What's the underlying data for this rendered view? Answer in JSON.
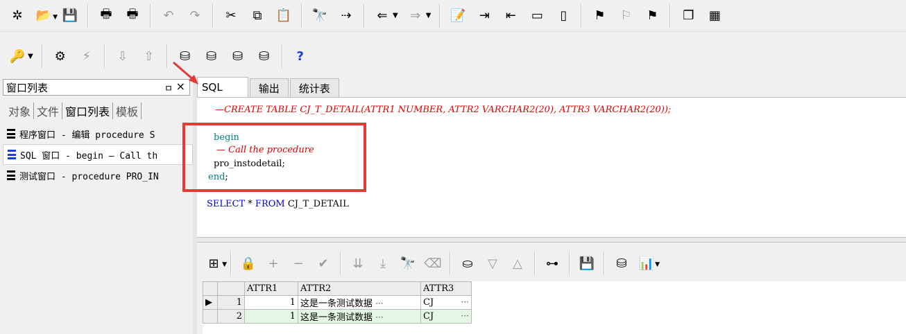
{
  "left_panel": {
    "title": "窗口列表",
    "pin_glyph": "ㅁ",
    "close_glyph": "×",
    "tabs": [
      "对象",
      "文件",
      "窗口列表",
      "模板"
    ],
    "windows": [
      {
        "label": "程序窗口 - 编辑 procedure S"
      },
      {
        "label": "SQL 窗口 - begin — Call th"
      },
      {
        "label": "测试窗口 - procedure PRO_IN"
      }
    ]
  },
  "editor_tabs": [
    "SQL",
    "输出",
    "统计表"
  ],
  "editor": {
    "line1": "—CREATE TABLE CJ_T_DETAIL(ATTR1 NUMBER, ATTR2 VARCHAR2(20), ATTR3 VARCHAR2(20));",
    "line2": "begin",
    "line3": "— Call the procedure",
    "line4": "pro_instodetail;",
    "line5_kw": "end",
    "line5_rest": ";",
    "line6_kw1": "SELECT",
    "line6_star": "*",
    "line6_kw2": "FROM",
    "line6_rest": "CJ_T_DETAIL"
  },
  "grid": {
    "columns": [
      "ATTR1",
      "ATTR2",
      "ATTR3"
    ],
    "rows": [
      {
        "num": "1",
        "attr1": "1",
        "attr2": "这是一条测试数据",
        "attr3": "CJ"
      },
      {
        "num": "2",
        "attr1": "1",
        "attr2": "这是一条测试数据",
        "attr3": "CJ"
      }
    ],
    "ellipsis": "···"
  },
  "toolbar_help": "?",
  "colors": {
    "highlight": "#e53935",
    "keyword": "#0000d0",
    "comment": "#e00000"
  }
}
